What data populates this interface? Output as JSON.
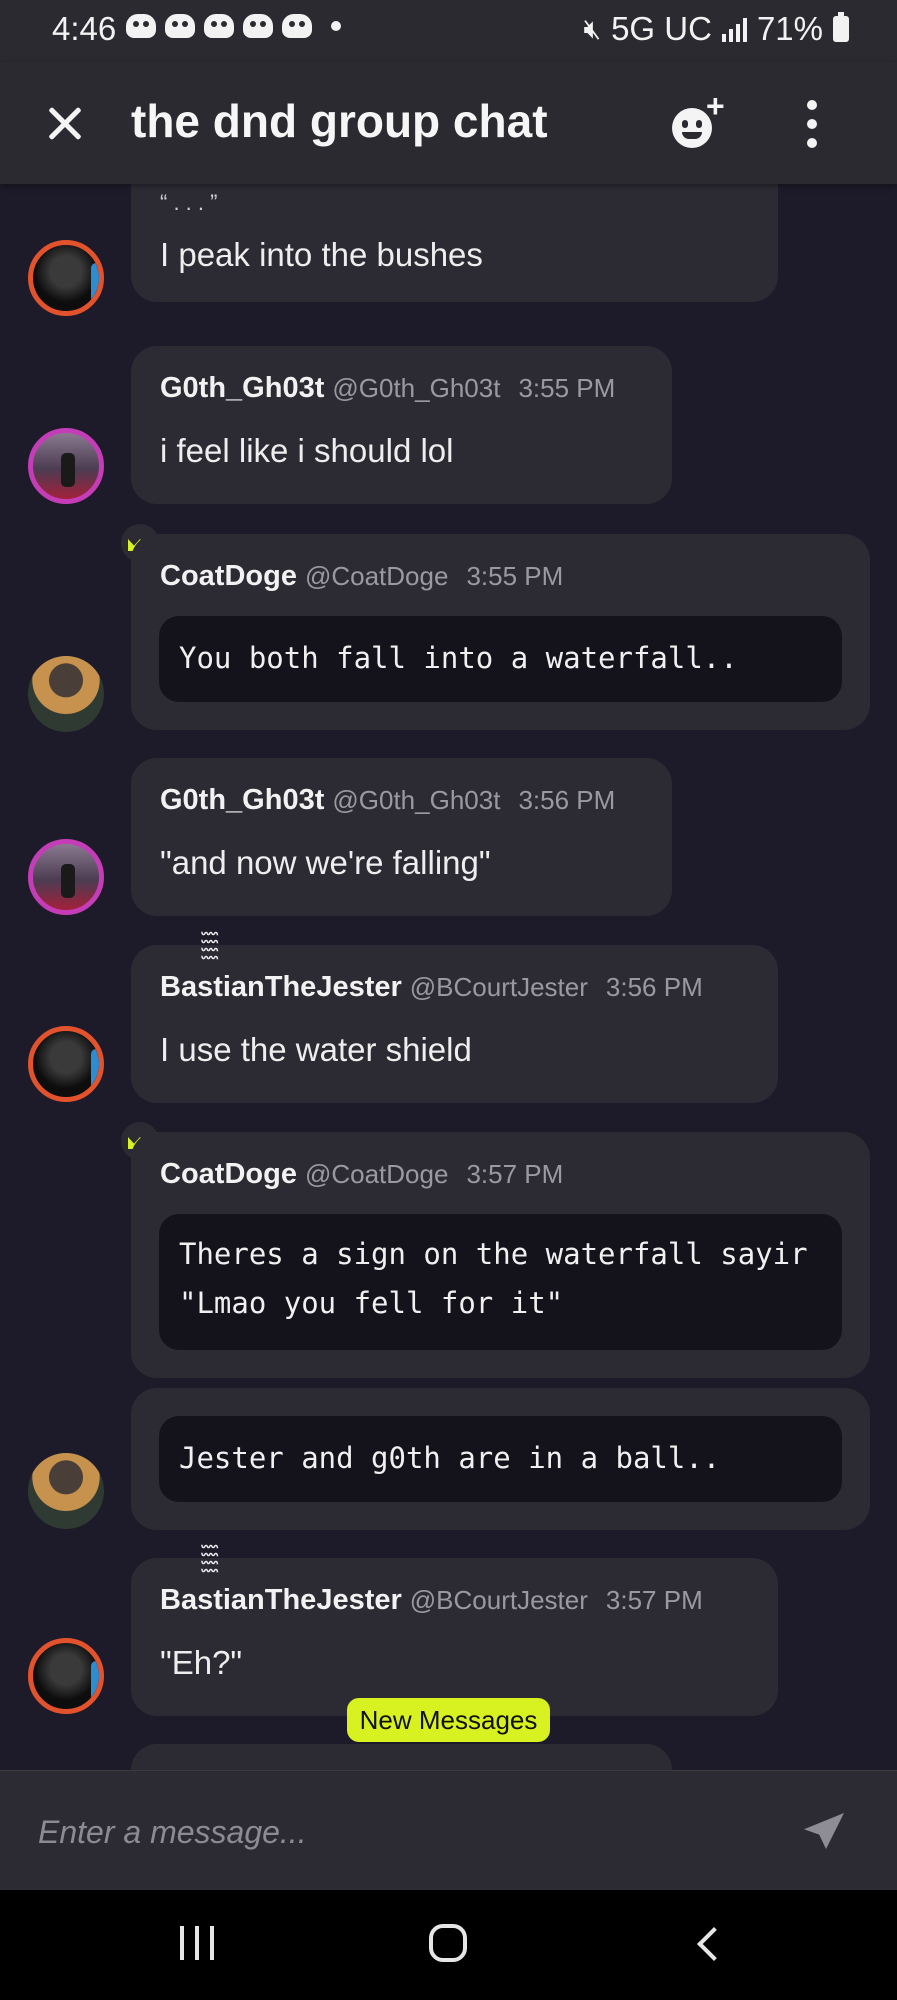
{
  "status_bar": {
    "time": "4:46",
    "network": "5G UC",
    "battery": "71%"
  },
  "header": {
    "title": "the dnd group chat"
  },
  "messages": [
    {
      "text_top": "“ . . . ”",
      "text": "I peak into the bushes"
    },
    {
      "name": "G0th_Gh03t",
      "handle": "@G0th_Gh03t",
      "time": "3:55 PM",
      "text": "i feel like i should lol"
    },
    {
      "name": "CoatDoge",
      "handle": "@CoatDoge",
      "time": "3:55 PM",
      "code": "You both fall into a waterfall.."
    },
    {
      "name": "G0th_Gh03t",
      "handle": "@G0th_Gh03t",
      "time": "3:56 PM",
      "text": "\"and now we're falling\""
    },
    {
      "name": "BastianTheJester",
      "handle": "@BCourtJester",
      "time": "3:56 PM",
      "text": "I use the water shield"
    },
    {
      "name": "CoatDoge",
      "handle": "@CoatDoge",
      "time": "3:57 PM",
      "code": "Theres a sign on the waterfall sayir\n\"Lmao you fell for it\""
    },
    {
      "code": "Jester and g0th are in a ball.."
    },
    {
      "name": "BastianTheJester",
      "handle": "@BCourtJester",
      "time": "3:57 PM",
      "text": "\"Eh?\""
    }
  ],
  "new_messages_label": "New Messages",
  "composer": {
    "placeholder": "Enter a message..."
  },
  "colors": {
    "accent": "#d7f220",
    "background": "#1d1b29",
    "bubble": "#2c2b33"
  }
}
